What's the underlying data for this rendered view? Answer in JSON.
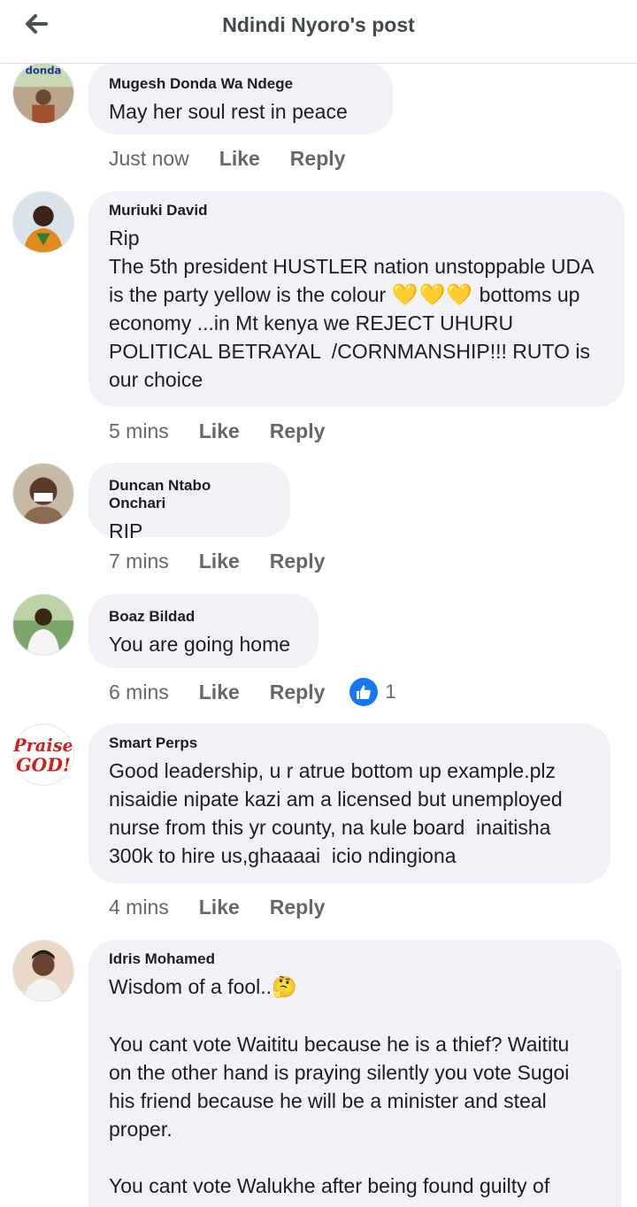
{
  "header": {
    "title": "Ndindi Nyoro's post",
    "back_icon": "arrow-left-icon"
  },
  "colors": {
    "bubble_bg": "#f0f2f5",
    "like_blue": "#1877f2",
    "meta_gray": "#65676b",
    "text_dark": "#1c1e21"
  },
  "comments": [
    {
      "author": "Mugesh Donda Wa Ndege",
      "text": "May her soul rest in peace",
      "time": "Just now",
      "like": "Like",
      "reply": "Reply",
      "avatar_label": "donda"
    },
    {
      "author": "Muriuki David",
      "text_lines": [
        "Rip",
        "The 5th president HUSTLER nation unstoppable UDA",
        "is the party yellow is the colour",
        "bottoms up",
        "economy ...in Mt kenya we REJECT UHURU",
        "POLITICAL BETRAYAL  /CORNMANSHIP!!! RUTO is",
        "our choice"
      ],
      "emoji": "💛💛💛",
      "time": "5 mins",
      "like": "Like",
      "reply": "Reply"
    },
    {
      "author": "Duncan Ntabo Onchari",
      "text": "RIP",
      "time": "7 mins",
      "like": "Like",
      "reply": "Reply"
    },
    {
      "author": "Boaz Bildad",
      "text": "You are going home",
      "time": "6 mins",
      "like": "Like",
      "reply": "Reply",
      "reaction_count": "1",
      "reaction_icon": "thumbs-up-icon"
    },
    {
      "author": "Smart Perps",
      "text_lines": [
        "Good leadership, u r atrue bottom up example.plz",
        "nisaidie nipate kazi am a licensed but unemployed",
        "nurse from this yr county, na kule board  inaitisha",
        "300k to hire us,ghaaaai  icio ndingiona"
      ],
      "time": "4 mins",
      "like": "Like",
      "reply": "Reply",
      "avatar_label": [
        "Praise",
        "GOD!"
      ]
    },
    {
      "author": "Idris Mohamed",
      "text_lines": [
        "Wisdom of a fool..",
        "",
        "You cant vote Waititu because he is a thief? Waititu",
        "on the other hand is praying silently you vote Sugoi",
        "his friend because he will be a minister and steal",
        "proper.",
        "",
        "You cant vote Walukhe after being found guilty of"
      ],
      "emoji": "🤔"
    }
  ]
}
